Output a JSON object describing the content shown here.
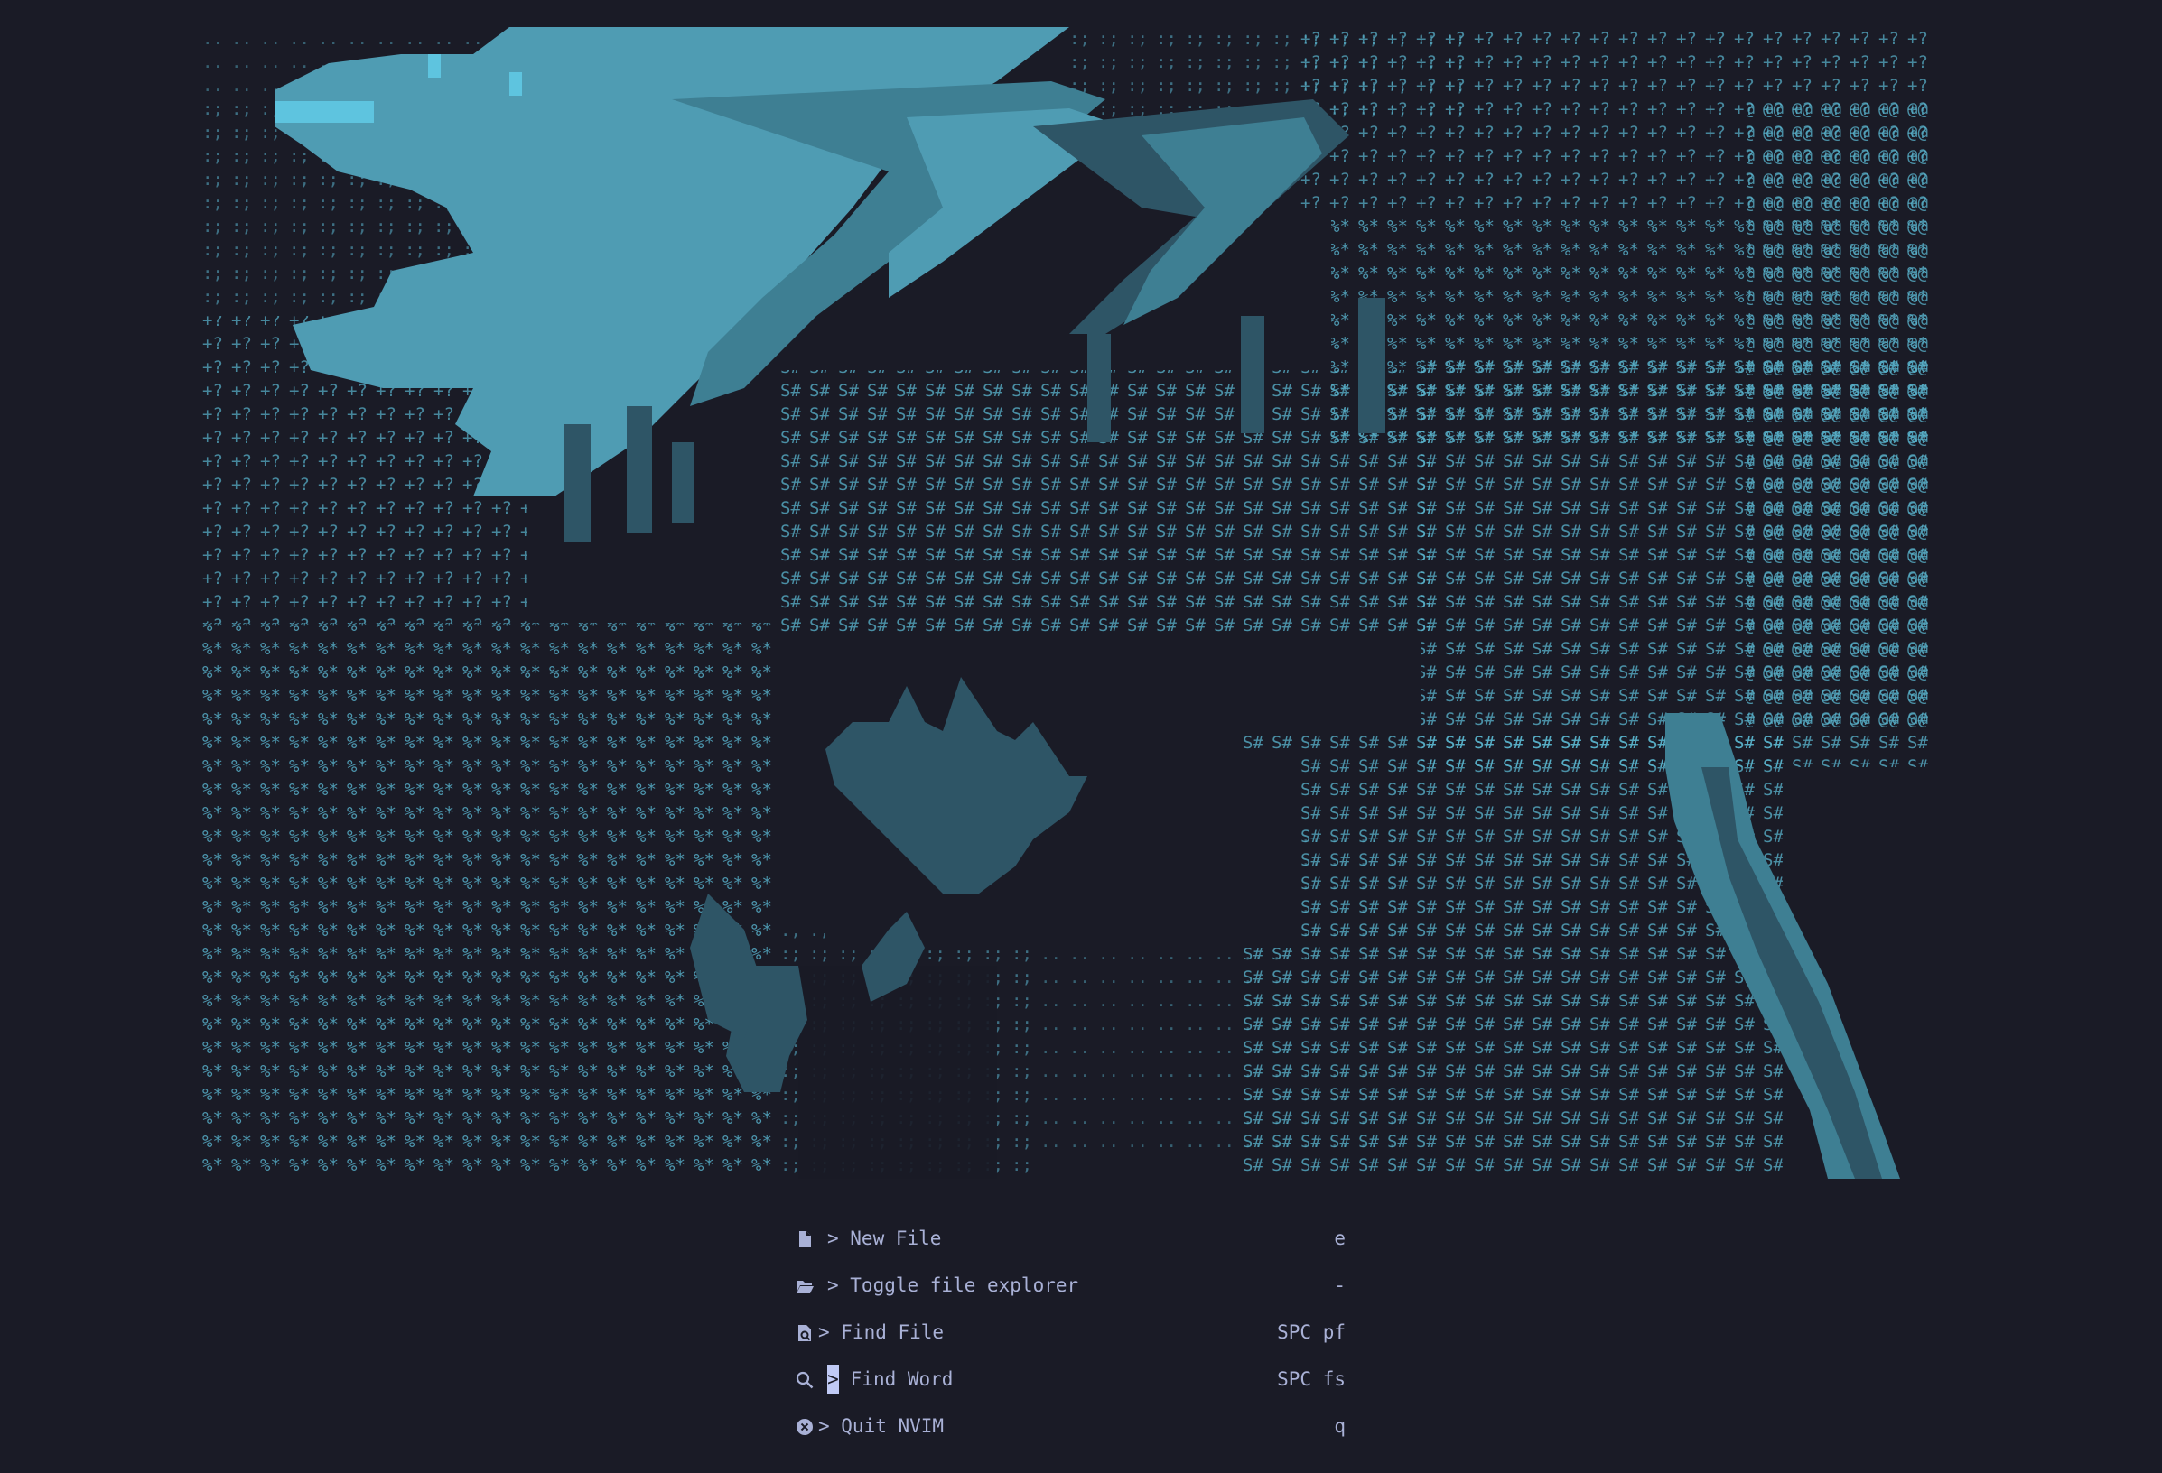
{
  "theme": {
    "background": "#1a1b26",
    "text": "#a9b1d6",
    "art_dark": "#2e5566",
    "art_mid": "#3e7f93",
    "art_light": "#4f9cb3",
    "art_bright": "#5ec4df",
    "ascii_color": "#59b5cf"
  },
  "dashboard": {
    "menu": [
      {
        "icon": "file-icon",
        "label": "> New File",
        "shortcut": "e"
      },
      {
        "icon": "folder-open-icon",
        "label": "> Toggle file explorer",
        "shortcut": "-"
      },
      {
        "icon": "file-search-icon",
        "label": "> Find File",
        "shortcut": "SPC pf"
      },
      {
        "icon": "search-icon",
        "label": "Find Word",
        "cursor": ">",
        "shortcut": "SPC fs"
      },
      {
        "icon": "close-circle-icon",
        "label": "> Quit NVIM",
        "shortcut": "q"
      }
    ]
  }
}
